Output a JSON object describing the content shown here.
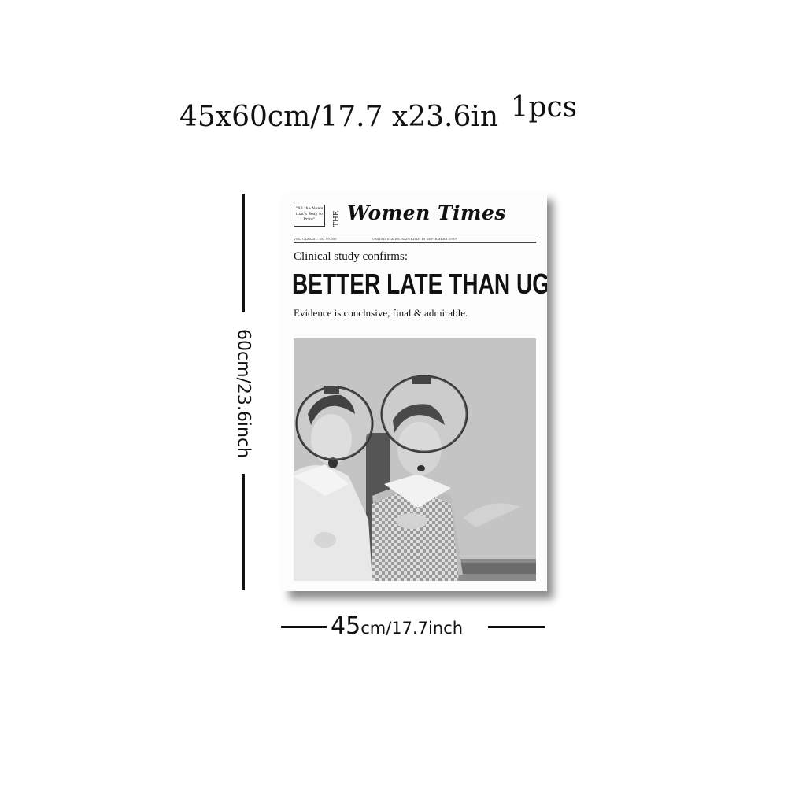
{
  "size_line": {
    "main": "45x60cm/17.7 x23.6in",
    "pcs": "1pcs"
  },
  "height_label": "60cm/23.6inch",
  "width_label": {
    "big": "45",
    "rest": "cm/17.7inch"
  },
  "poster": {
    "motto": "\"All the News that's Sexy to Print\"",
    "the": "THE",
    "masthead": "Women Times",
    "dateline_left": "VOL. CLXXIII... NO 59,000",
    "dateline_right": "UNITED STATES, SATURDAY, 10 SEPTEMBER 1959",
    "subhead": "Clinical study confirms:",
    "headline": "BETTER LATE THAN UGLY",
    "deck": "Evidence is conclusive, final & admirable."
  }
}
